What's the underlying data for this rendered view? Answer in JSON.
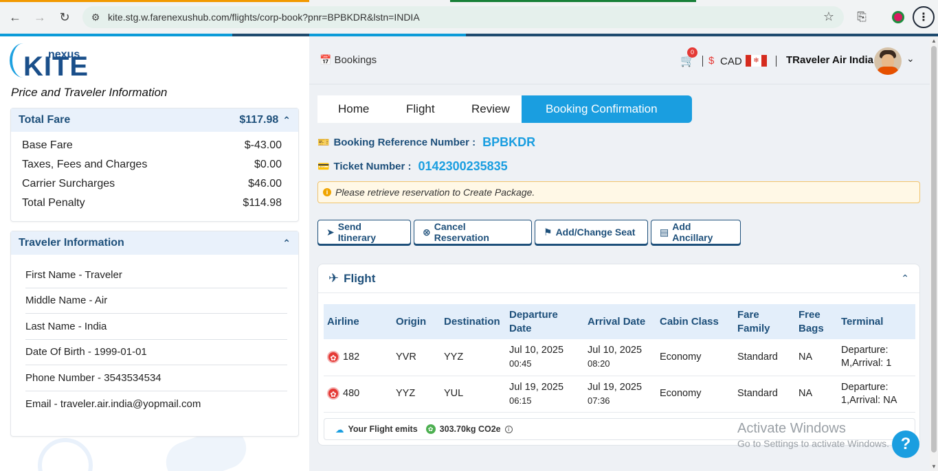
{
  "browser": {
    "url": "kite.stg.w.farenexushub.com/flights/corp-book?pnr=BPBKDR&lstn=INDIA"
  },
  "logo": {
    "brand": "KITE",
    "sub": "nexus"
  },
  "left": {
    "title": "Price and Traveler Information",
    "fare": {
      "header": "Total Fare",
      "total": "$117.98",
      "rows": [
        {
          "label": "Base Fare",
          "value": "$-43.00"
        },
        {
          "label": "Taxes, Fees and Charges",
          "value": "$0.00"
        },
        {
          "label": "Carrier Surcharges",
          "value": "$46.00"
        },
        {
          "label": "Total Penalty",
          "value": "$114.98"
        }
      ]
    },
    "traveler": {
      "header": "Traveler Information",
      "rows": [
        "First Name - Traveler",
        "Middle Name - Air",
        "Last Name - India",
        "Date Of Birth - 1999-01-01",
        "Phone Number - 3543534534",
        "Email - traveler.air.india@yopmail.com"
      ]
    }
  },
  "header": {
    "bookings": "Bookings",
    "cart_count": "0",
    "currency_symbol": "$",
    "currency": "CAD",
    "user": "TRaveler Air India"
  },
  "breadcrumb": [
    "Home",
    "Flight",
    "Review",
    "Booking Confirmation"
  ],
  "booking": {
    "ref_label": "Booking Reference Number :",
    "ref_value": "BPBKDR",
    "ticket_label": "Ticket Number :",
    "ticket_value": "0142300235835",
    "alert": "Please retrieve reservation to Create Package."
  },
  "actions": [
    "Send Itinerary",
    "Cancel Reservation",
    "Add/Change Seat",
    "Add Ancillary"
  ],
  "flight": {
    "title": "Flight",
    "columns": [
      "Airline",
      "Origin",
      "Destination",
      "Departure Date",
      "Arrival Date",
      "Cabin Class",
      "Fare Family",
      "Free Bags",
      "Terminal"
    ],
    "rows": [
      {
        "flight_no": "182",
        "origin": "YVR",
        "destination": "YYZ",
        "dep_date": "Jul 10, 2025",
        "dep_time": "00:45",
        "arr_date": "Jul 10, 2025",
        "arr_time": "08:20",
        "cabin": "Economy",
        "fare_family": "Standard",
        "bags": "NA",
        "terminal": "Departure: M,Arrival: 1"
      },
      {
        "flight_no": "480",
        "origin": "YYZ",
        "destination": "YUL",
        "dep_date": "Jul 19, 2025",
        "dep_time": "06:15",
        "arr_date": "Jul 19, 2025",
        "arr_time": "07:36",
        "cabin": "Economy",
        "fare_family": "Standard",
        "bags": "NA",
        "terminal": "Departure: 1,Arrival: NA"
      }
    ],
    "emits_label": "Your Flight emits",
    "emits_value": "303.70kg CO2e"
  },
  "watermark": {
    "line1": "Activate Windows",
    "line2": "Go to Settings to activate Windows."
  },
  "help": "?"
}
